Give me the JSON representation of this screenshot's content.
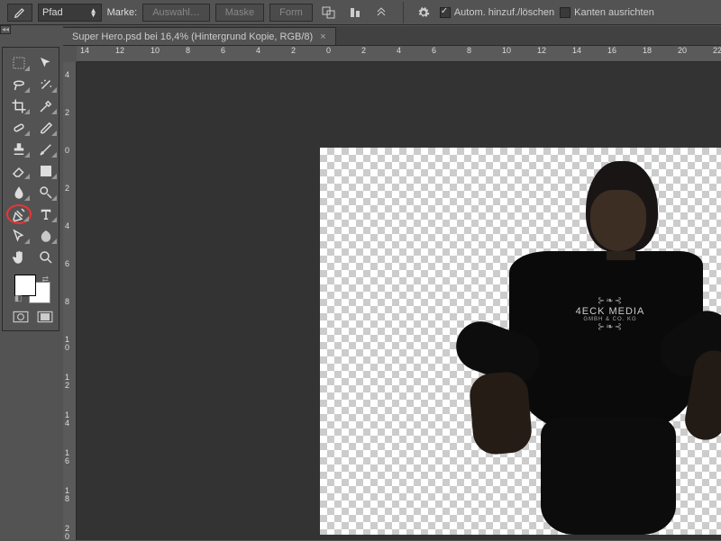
{
  "options": {
    "mode": "Pfad",
    "marker_label": "Marke:",
    "btn_sel": "Auswahl…",
    "btn_mask": "Maske",
    "btn_shape": "Form",
    "auto_add_label": "Autom. hinzuf./löschen",
    "rubber_label": "Kanten ausrichten"
  },
  "tab": {
    "title": "Super Hero.psd bei 16,4% (Hintergrund Kopie, RGB/8)"
  },
  "ruler_h": [
    "14",
    "12",
    "10",
    "8",
    "6",
    "4",
    "2",
    "0",
    "2",
    "4",
    "6",
    "8",
    "10",
    "12",
    "14",
    "16",
    "18",
    "20",
    "22"
  ],
  "ruler_v": [
    "4",
    "2",
    "0",
    "2",
    "4",
    "6",
    "8",
    "10",
    "12",
    "14",
    "16",
    "18",
    "20"
  ],
  "tshirt": {
    "line1": "4ECK MEDIA",
    "line2": "GMBH & CO. KG"
  },
  "tool_names": [
    "marquee",
    "move",
    "lasso",
    "wand",
    "crop",
    "eyedropper",
    "heal",
    "brush",
    "stamp",
    "history",
    "eraser",
    "gradient",
    "blur",
    "dodge",
    "pen",
    "type",
    "path-select",
    "shape",
    "hand",
    "zoom"
  ]
}
